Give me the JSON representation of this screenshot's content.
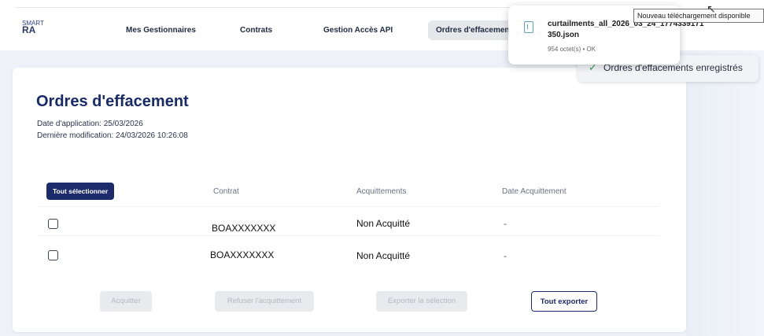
{
  "app": {
    "logo_top": "SMART",
    "logo_main": "RA"
  },
  "nav": {
    "items": [
      {
        "label": "Mes Gestionnaires"
      },
      {
        "label": "Contrats"
      },
      {
        "label": "Gestion Accès API"
      },
      {
        "label": "Ordres d'effacement"
      }
    ]
  },
  "page": {
    "title": "Ordres d'effacement",
    "date_application": "Date d'application: 25/03/2026",
    "derniere_modification": "Dernière modification: 24/03/2026 10:26:08"
  },
  "table": {
    "select_all_label": "Tout sélectionner",
    "headers": [
      "Contrat",
      "Acquittements",
      "Date Acquittement"
    ],
    "rows": [
      {
        "contrat": "BOAXXXXXXX",
        "acquittement": "Non Acquitté",
        "date": "-"
      },
      {
        "contrat": "BOAXXXXXXX",
        "acquittement": "Non Acquitté",
        "date": "-"
      }
    ]
  },
  "actions": {
    "acquitter": "Acquitter",
    "refuser": "Refuser l'acquittement",
    "exporter_selection": "Exporter la sélection",
    "tout_exporter": "Tout exporter"
  },
  "toast": {
    "message": "Ordres d'effacements enregistrés",
    "icon": "check-icon"
  },
  "download": {
    "filename": "curtailments_all_2026_03_24_1774339171 350.json",
    "meta": "954 octet(s) • OK",
    "tooltip": "Nouveau téléchargement disponible",
    "icon": "file-icon"
  }
}
